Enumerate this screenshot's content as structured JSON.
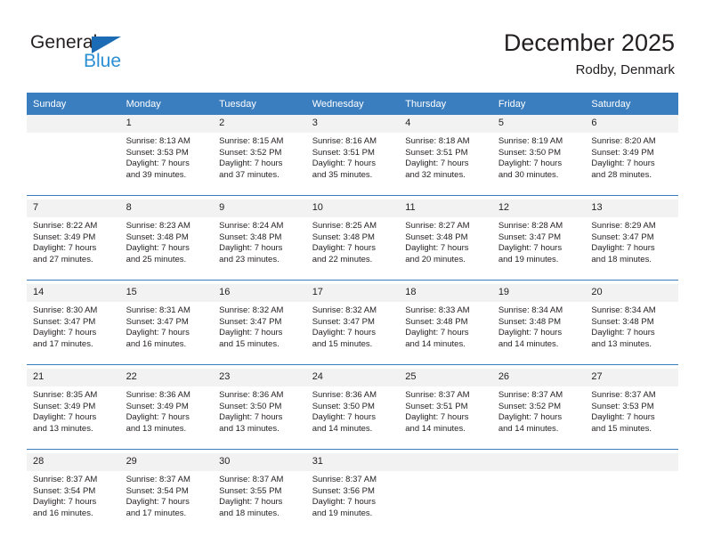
{
  "brand": {
    "name_part1": "General",
    "name_part2": "Blue",
    "triangle_icon": "triangle-icon",
    "accent_color": "#1b6cb5",
    "secondary_color": "#2a8fd4"
  },
  "header": {
    "title": "December 2025",
    "subtitle": "Rodby, Denmark"
  },
  "calendar": {
    "header_color": "#3b7ebf",
    "daynum_band_color": "#f2f2f2",
    "weekdays": [
      "Sunday",
      "Monday",
      "Tuesday",
      "Wednesday",
      "Thursday",
      "Friday",
      "Saturday"
    ],
    "weeks": [
      {
        "days": [
          {
            "num": "",
            "sunrise": "",
            "sunset": "",
            "daylight_1": "",
            "daylight_2": ""
          },
          {
            "num": "1",
            "sunrise": "Sunrise: 8:13 AM",
            "sunset": "Sunset: 3:53 PM",
            "daylight_1": "Daylight: 7 hours",
            "daylight_2": "and 39 minutes."
          },
          {
            "num": "2",
            "sunrise": "Sunrise: 8:15 AM",
            "sunset": "Sunset: 3:52 PM",
            "daylight_1": "Daylight: 7 hours",
            "daylight_2": "and 37 minutes."
          },
          {
            "num": "3",
            "sunrise": "Sunrise: 8:16 AM",
            "sunset": "Sunset: 3:51 PM",
            "daylight_1": "Daylight: 7 hours",
            "daylight_2": "and 35 minutes."
          },
          {
            "num": "4",
            "sunrise": "Sunrise: 8:18 AM",
            "sunset": "Sunset: 3:51 PM",
            "daylight_1": "Daylight: 7 hours",
            "daylight_2": "and 32 minutes."
          },
          {
            "num": "5",
            "sunrise": "Sunrise: 8:19 AM",
            "sunset": "Sunset: 3:50 PM",
            "daylight_1": "Daylight: 7 hours",
            "daylight_2": "and 30 minutes."
          },
          {
            "num": "6",
            "sunrise": "Sunrise: 8:20 AM",
            "sunset": "Sunset: 3:49 PM",
            "daylight_1": "Daylight: 7 hours",
            "daylight_2": "and 28 minutes."
          }
        ]
      },
      {
        "days": [
          {
            "num": "7",
            "sunrise": "Sunrise: 8:22 AM",
            "sunset": "Sunset: 3:49 PM",
            "daylight_1": "Daylight: 7 hours",
            "daylight_2": "and 27 minutes."
          },
          {
            "num": "8",
            "sunrise": "Sunrise: 8:23 AM",
            "sunset": "Sunset: 3:48 PM",
            "daylight_1": "Daylight: 7 hours",
            "daylight_2": "and 25 minutes."
          },
          {
            "num": "9",
            "sunrise": "Sunrise: 8:24 AM",
            "sunset": "Sunset: 3:48 PM",
            "daylight_1": "Daylight: 7 hours",
            "daylight_2": "and 23 minutes."
          },
          {
            "num": "10",
            "sunrise": "Sunrise: 8:25 AM",
            "sunset": "Sunset: 3:48 PM",
            "daylight_1": "Daylight: 7 hours",
            "daylight_2": "and 22 minutes."
          },
          {
            "num": "11",
            "sunrise": "Sunrise: 8:27 AM",
            "sunset": "Sunset: 3:48 PM",
            "daylight_1": "Daylight: 7 hours",
            "daylight_2": "and 20 minutes."
          },
          {
            "num": "12",
            "sunrise": "Sunrise: 8:28 AM",
            "sunset": "Sunset: 3:47 PM",
            "daylight_1": "Daylight: 7 hours",
            "daylight_2": "and 19 minutes."
          },
          {
            "num": "13",
            "sunrise": "Sunrise: 8:29 AM",
            "sunset": "Sunset: 3:47 PM",
            "daylight_1": "Daylight: 7 hours",
            "daylight_2": "and 18 minutes."
          }
        ]
      },
      {
        "days": [
          {
            "num": "14",
            "sunrise": "Sunrise: 8:30 AM",
            "sunset": "Sunset: 3:47 PM",
            "daylight_1": "Daylight: 7 hours",
            "daylight_2": "and 17 minutes."
          },
          {
            "num": "15",
            "sunrise": "Sunrise: 8:31 AM",
            "sunset": "Sunset: 3:47 PM",
            "daylight_1": "Daylight: 7 hours",
            "daylight_2": "and 16 minutes."
          },
          {
            "num": "16",
            "sunrise": "Sunrise: 8:32 AM",
            "sunset": "Sunset: 3:47 PM",
            "daylight_1": "Daylight: 7 hours",
            "daylight_2": "and 15 minutes."
          },
          {
            "num": "17",
            "sunrise": "Sunrise: 8:32 AM",
            "sunset": "Sunset: 3:47 PM",
            "daylight_1": "Daylight: 7 hours",
            "daylight_2": "and 15 minutes."
          },
          {
            "num": "18",
            "sunrise": "Sunrise: 8:33 AM",
            "sunset": "Sunset: 3:48 PM",
            "daylight_1": "Daylight: 7 hours",
            "daylight_2": "and 14 minutes."
          },
          {
            "num": "19",
            "sunrise": "Sunrise: 8:34 AM",
            "sunset": "Sunset: 3:48 PM",
            "daylight_1": "Daylight: 7 hours",
            "daylight_2": "and 14 minutes."
          },
          {
            "num": "20",
            "sunrise": "Sunrise: 8:34 AM",
            "sunset": "Sunset: 3:48 PM",
            "daylight_1": "Daylight: 7 hours",
            "daylight_2": "and 13 minutes."
          }
        ]
      },
      {
        "days": [
          {
            "num": "21",
            "sunrise": "Sunrise: 8:35 AM",
            "sunset": "Sunset: 3:49 PM",
            "daylight_1": "Daylight: 7 hours",
            "daylight_2": "and 13 minutes."
          },
          {
            "num": "22",
            "sunrise": "Sunrise: 8:36 AM",
            "sunset": "Sunset: 3:49 PM",
            "daylight_1": "Daylight: 7 hours",
            "daylight_2": "and 13 minutes."
          },
          {
            "num": "23",
            "sunrise": "Sunrise: 8:36 AM",
            "sunset": "Sunset: 3:50 PM",
            "daylight_1": "Daylight: 7 hours",
            "daylight_2": "and 13 minutes."
          },
          {
            "num": "24",
            "sunrise": "Sunrise: 8:36 AM",
            "sunset": "Sunset: 3:50 PM",
            "daylight_1": "Daylight: 7 hours",
            "daylight_2": "and 14 minutes."
          },
          {
            "num": "25",
            "sunrise": "Sunrise: 8:37 AM",
            "sunset": "Sunset: 3:51 PM",
            "daylight_1": "Daylight: 7 hours",
            "daylight_2": "and 14 minutes."
          },
          {
            "num": "26",
            "sunrise": "Sunrise: 8:37 AM",
            "sunset": "Sunset: 3:52 PM",
            "daylight_1": "Daylight: 7 hours",
            "daylight_2": "and 14 minutes."
          },
          {
            "num": "27",
            "sunrise": "Sunrise: 8:37 AM",
            "sunset": "Sunset: 3:53 PM",
            "daylight_1": "Daylight: 7 hours",
            "daylight_2": "and 15 minutes."
          }
        ]
      },
      {
        "days": [
          {
            "num": "28",
            "sunrise": "Sunrise: 8:37 AM",
            "sunset": "Sunset: 3:54 PM",
            "daylight_1": "Daylight: 7 hours",
            "daylight_2": "and 16 minutes."
          },
          {
            "num": "29",
            "sunrise": "Sunrise: 8:37 AM",
            "sunset": "Sunset: 3:54 PM",
            "daylight_1": "Daylight: 7 hours",
            "daylight_2": "and 17 minutes."
          },
          {
            "num": "30",
            "sunrise": "Sunrise: 8:37 AM",
            "sunset": "Sunset: 3:55 PM",
            "daylight_1": "Daylight: 7 hours",
            "daylight_2": "and 18 minutes."
          },
          {
            "num": "31",
            "sunrise": "Sunrise: 8:37 AM",
            "sunset": "Sunset: 3:56 PM",
            "daylight_1": "Daylight: 7 hours",
            "daylight_2": "and 19 minutes."
          },
          {
            "num": "",
            "sunrise": "",
            "sunset": "",
            "daylight_1": "",
            "daylight_2": ""
          },
          {
            "num": "",
            "sunrise": "",
            "sunset": "",
            "daylight_1": "",
            "daylight_2": ""
          },
          {
            "num": "",
            "sunrise": "",
            "sunset": "",
            "daylight_1": "",
            "daylight_2": ""
          }
        ]
      }
    ]
  }
}
